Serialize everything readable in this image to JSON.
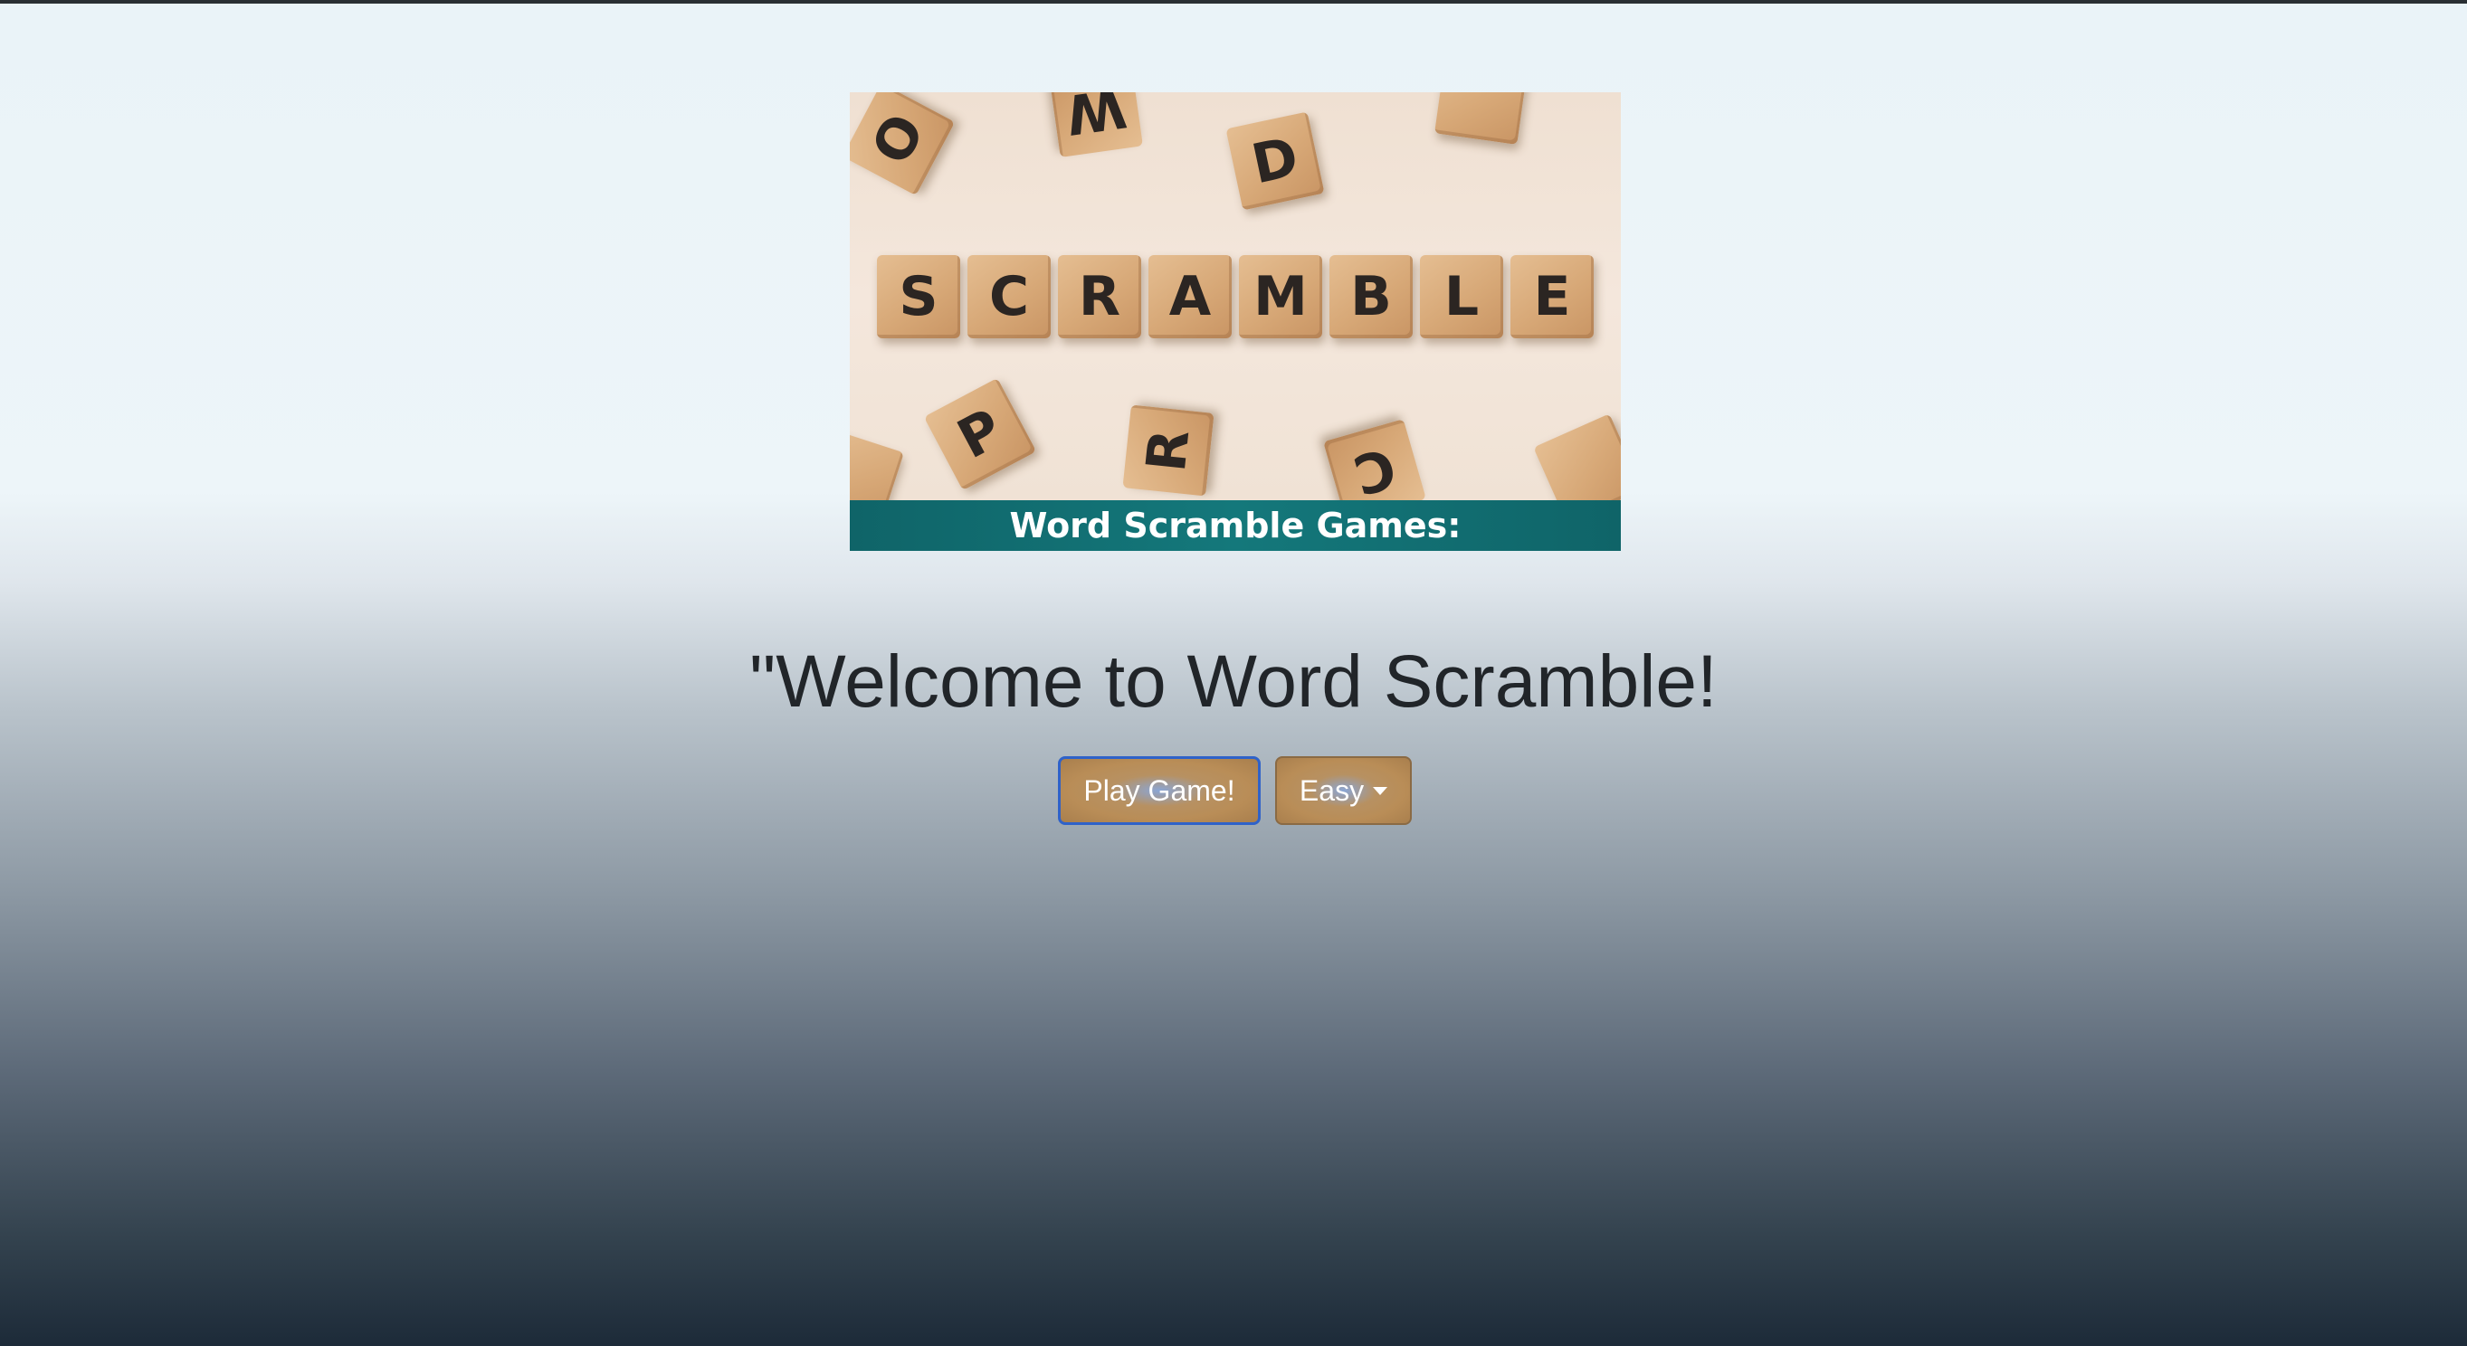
{
  "banner": {
    "caption": "Word Scramble Games:",
    "tiles_main": [
      "S",
      "C",
      "R",
      "A",
      "M",
      "B",
      "L",
      "E"
    ],
    "tiles_scattered": [
      "O",
      "W",
      "D",
      "P",
      "R",
      "C"
    ]
  },
  "heading": "\"Welcome to Word Scramble!",
  "actions": {
    "play_label": "Play Game!",
    "level_label": "Easy"
  },
  "colors": {
    "button_bg": "#b98d57",
    "button_focus_border": "#2f62c9",
    "caption_bg": "#14787b",
    "heading_text": "#212529"
  }
}
